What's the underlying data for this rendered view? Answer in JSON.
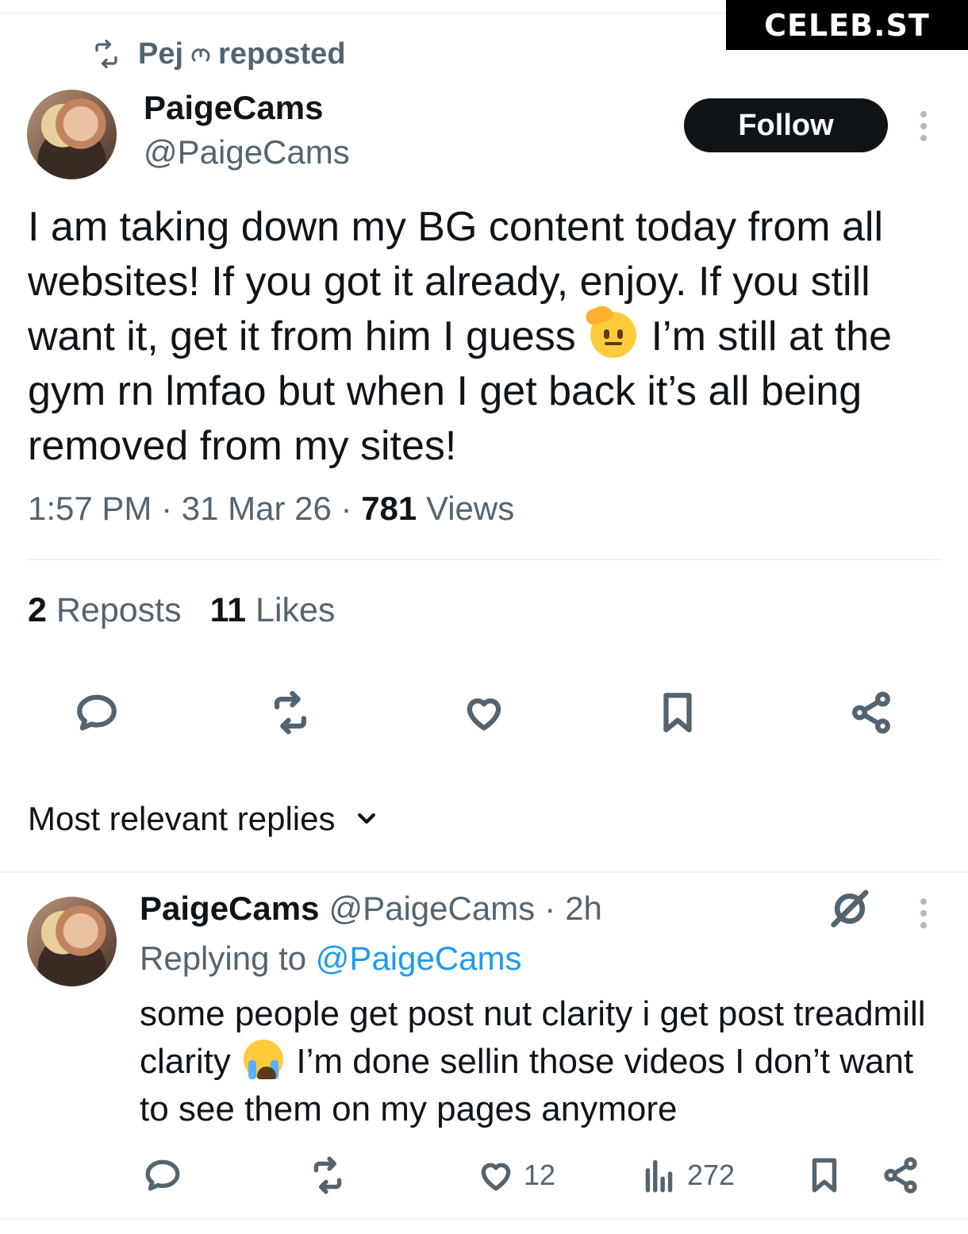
{
  "watermark": "CELEB.ST",
  "repost_banner": {
    "user": "Pej",
    "label": "reposted"
  },
  "tweet": {
    "author_name": "PaigeCams",
    "author_handle": "@PaigeCams",
    "follow_label": "Follow",
    "text_part1": "I am taking down my BG content today from all websites! If you got it already, enjoy. If you still want it, get it from him I guess",
    "text_part2": "I’m still at the gym rn lmfao but when I get back it’s all being removed from my sites!",
    "emoji_name": "saluting-face-emoji",
    "time": "1:57 PM",
    "date": "31 Mar 26",
    "views_count": "781",
    "views_label": "Views",
    "reposts_count": "2",
    "reposts_label": "Reposts",
    "likes_count": "11",
    "likes_label": "Likes"
  },
  "actions": [
    "reply-icon",
    "repost-icon",
    "like-icon",
    "bookmark-icon",
    "share-icon"
  ],
  "replies_header": {
    "label": "Most relevant replies"
  },
  "reply": {
    "author_name": "PaigeCams",
    "author_handle": "@PaigeCams",
    "separator": "·",
    "time_ago": "2h",
    "replying_label": "Replying to",
    "replying_handle": "@PaigeCams",
    "text_part1": "some people get post nut clarity i get post treadmill clarity",
    "text_part2": "I’m done sellin those videos I don’t want to see them on my pages anymore",
    "emoji_name": "loudly-crying-face-emoji",
    "likes": "12",
    "views": "272"
  },
  "colors": {
    "text": "#0f1419",
    "muted": "#536471",
    "link": "#1d9bf0",
    "button": "#0f1419"
  }
}
